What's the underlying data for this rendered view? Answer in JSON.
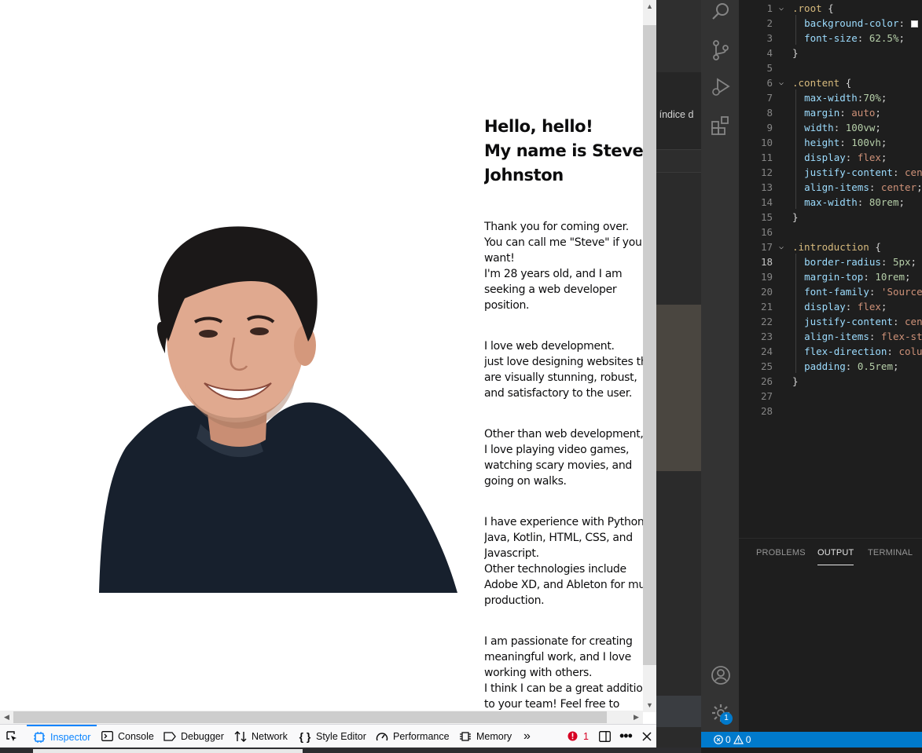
{
  "browser": {
    "heading": [
      "Hello, hello!",
      "My name is Steven",
      "Johnston"
    ],
    "paragraphs": [
      [
        "Thank you for coming over.",
        "You can call me \"Steve\" if you",
        "want!",
        "I'm 28 years old, and I am",
        "seeking a web developer",
        "position."
      ],
      [
        "I love web development.",
        "just love designing websites th",
        "are visually stunning, robust,",
        "and satisfactory to the user."
      ],
      [
        "Other than web development,",
        "I love playing video games,",
        "watching scary movies, and",
        "going on walks."
      ],
      [
        "I have experience with Python,",
        "Java, Kotlin, HTML, CSS, and",
        "Javascript.",
        "Other technologies include",
        "Adobe XD, and Ableton for mus",
        "production."
      ],
      [
        "I am passionate for creating",
        "meaningful work, and I love",
        "working with others.",
        "I think I can be a great additio",
        "to your team! Feel free to"
      ]
    ]
  },
  "devtools": {
    "tabs": [
      "Inspector",
      "Console",
      "Debugger",
      "Network",
      "Style Editor",
      "Performance",
      "Memory"
    ],
    "selected_tab": "Inspector",
    "error_count": "1"
  },
  "background_window": {
    "snippet": "r índice d"
  },
  "editor": {
    "current_line": 18,
    "lines": [
      {
        "n": "1",
        "fold": true,
        "tokens": [
          [
            ".root ",
            "sel"
          ],
          [
            "{",
            "plain"
          ]
        ]
      },
      {
        "n": "2",
        "tokens": [
          [
            "  ",
            "plain"
          ],
          [
            "background-color",
            "prop"
          ],
          [
            ": ",
            "plain"
          ]
        ],
        "swatch": true
      },
      {
        "n": "3",
        "tokens": [
          [
            "  ",
            "plain"
          ],
          [
            "font-size",
            "prop"
          ],
          [
            ": ",
            "plain"
          ],
          [
            "62.5%",
            "num"
          ],
          [
            ";",
            "plain"
          ]
        ]
      },
      {
        "n": "4",
        "tokens": [
          [
            "}",
            "plain"
          ]
        ]
      },
      {
        "n": "5",
        "tokens": []
      },
      {
        "n": "6",
        "fold": true,
        "tokens": [
          [
            ".content ",
            "sel"
          ],
          [
            "{",
            "plain"
          ]
        ]
      },
      {
        "n": "7",
        "tokens": [
          [
            "  ",
            "plain"
          ],
          [
            "max-width",
            "prop"
          ],
          [
            ":",
            "plain"
          ],
          [
            "70%",
            "num"
          ],
          [
            ";",
            "plain"
          ]
        ]
      },
      {
        "n": "8",
        "tokens": [
          [
            "  ",
            "plain"
          ],
          [
            "margin",
            "prop"
          ],
          [
            ": ",
            "plain"
          ],
          [
            "auto",
            "val"
          ],
          [
            ";",
            "plain"
          ]
        ]
      },
      {
        "n": "9",
        "tokens": [
          [
            "  ",
            "plain"
          ],
          [
            "width",
            "prop"
          ],
          [
            ": ",
            "plain"
          ],
          [
            "100vw",
            "num"
          ],
          [
            ";",
            "plain"
          ]
        ]
      },
      {
        "n": "10",
        "tokens": [
          [
            "  ",
            "plain"
          ],
          [
            "height",
            "prop"
          ],
          [
            ": ",
            "plain"
          ],
          [
            "100vh",
            "num"
          ],
          [
            ";",
            "plain"
          ]
        ]
      },
      {
        "n": "11",
        "tokens": [
          [
            "  ",
            "plain"
          ],
          [
            "display",
            "prop"
          ],
          [
            ": ",
            "plain"
          ],
          [
            "flex",
            "val"
          ],
          [
            ";",
            "plain"
          ]
        ]
      },
      {
        "n": "12",
        "tokens": [
          [
            "  ",
            "plain"
          ],
          [
            "justify-content",
            "prop"
          ],
          [
            ": ",
            "plain"
          ],
          [
            "cen",
            "val"
          ]
        ]
      },
      {
        "n": "13",
        "tokens": [
          [
            "  ",
            "plain"
          ],
          [
            "align-items",
            "prop"
          ],
          [
            ": ",
            "plain"
          ],
          [
            "center",
            "val"
          ],
          [
            ";",
            "plain"
          ]
        ]
      },
      {
        "n": "14",
        "tokens": [
          [
            "  ",
            "plain"
          ],
          [
            "max-width",
            "prop"
          ],
          [
            ": ",
            "plain"
          ],
          [
            "80rem",
            "num"
          ],
          [
            ";",
            "plain"
          ]
        ]
      },
      {
        "n": "15",
        "tokens": [
          [
            "}",
            "plain"
          ]
        ]
      },
      {
        "n": "16",
        "tokens": []
      },
      {
        "n": "17",
        "fold": true,
        "tokens": [
          [
            ".introduction ",
            "sel"
          ],
          [
            "{",
            "plain"
          ]
        ]
      },
      {
        "n": "18",
        "tokens": [
          [
            "  ",
            "plain"
          ],
          [
            "border-radius",
            "prop"
          ],
          [
            ": ",
            "plain"
          ],
          [
            "5px",
            "num"
          ],
          [
            ";",
            "plain"
          ]
        ]
      },
      {
        "n": "19",
        "tokens": [
          [
            "  ",
            "plain"
          ],
          [
            "margin-top",
            "prop"
          ],
          [
            ": ",
            "plain"
          ],
          [
            "10rem",
            "num"
          ],
          [
            ";",
            "plain"
          ]
        ]
      },
      {
        "n": "20",
        "tokens": [
          [
            "  ",
            "plain"
          ],
          [
            "font-family",
            "prop"
          ],
          [
            ": ",
            "plain"
          ],
          [
            "'Source",
            "val"
          ]
        ]
      },
      {
        "n": "21",
        "tokens": [
          [
            "  ",
            "plain"
          ],
          [
            "display",
            "prop"
          ],
          [
            ": ",
            "plain"
          ],
          [
            "flex",
            "val"
          ],
          [
            ";",
            "plain"
          ]
        ]
      },
      {
        "n": "22",
        "tokens": [
          [
            "  ",
            "plain"
          ],
          [
            "justify-content",
            "prop"
          ],
          [
            ": ",
            "plain"
          ],
          [
            "cen",
            "val"
          ]
        ]
      },
      {
        "n": "23",
        "tokens": [
          [
            "  ",
            "plain"
          ],
          [
            "align-items",
            "prop"
          ],
          [
            ": ",
            "plain"
          ],
          [
            "flex-st",
            "val"
          ]
        ]
      },
      {
        "n": "24",
        "tokens": [
          [
            "  ",
            "plain"
          ],
          [
            "flex-direction",
            "prop"
          ],
          [
            ": ",
            "plain"
          ],
          [
            "colu",
            "val"
          ]
        ]
      },
      {
        "n": "25",
        "tokens": [
          [
            "  ",
            "plain"
          ],
          [
            "padding",
            "prop"
          ],
          [
            ": ",
            "plain"
          ],
          [
            "0.5rem",
            "num"
          ],
          [
            ";",
            "plain"
          ]
        ]
      },
      {
        "n": "26",
        "tokens": [
          [
            "}",
            "plain"
          ]
        ]
      },
      {
        "n": "27",
        "tokens": []
      },
      {
        "n": "28",
        "tokens": []
      }
    ]
  },
  "panel": {
    "tabs": [
      "PROBLEMS",
      "OUTPUT",
      "TERMINAL"
    ],
    "active_tab": "OUTPUT"
  },
  "activity": {
    "settings_badge": "1"
  },
  "statusbar": {
    "errors": "0",
    "warnings": "0"
  }
}
